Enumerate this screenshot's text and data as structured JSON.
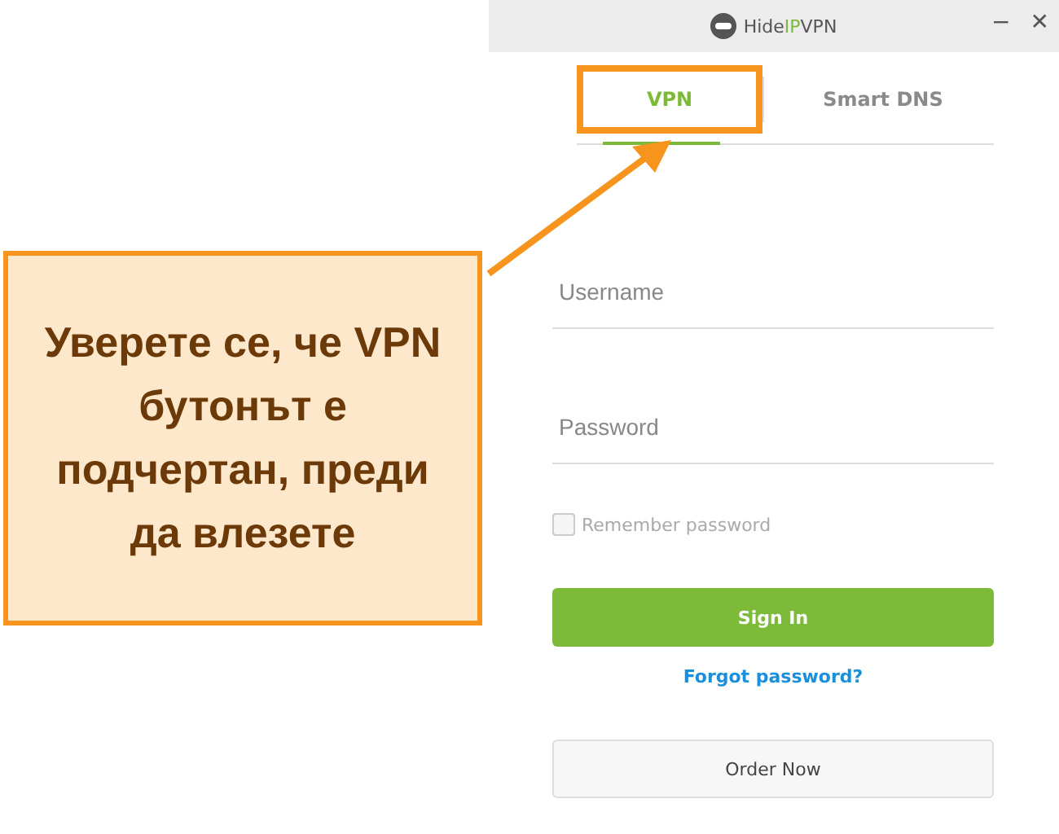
{
  "window": {
    "logo": [
      {
        "text": "Hide",
        "color": "#555555"
      },
      {
        "text": "IP",
        "color": "#7dba3a"
      },
      {
        "text": "VPN",
        "color": "#555555"
      }
    ],
    "controls": [
      "−",
      "✕"
    ]
  },
  "tabs": [
    {
      "label": "VPN",
      "selected": true,
      "highlighted": true
    },
    {
      "label": "Smart DNS",
      "selected": false,
      "highlighted": false
    }
  ],
  "form": {
    "username": {
      "placeholder": "Username"
    },
    "password": {
      "placeholder": "Password"
    },
    "remember": {
      "label": "Remember password",
      "checked": false
    },
    "sign_in": "Sign In",
    "forgot": "Forgot password?",
    "order": "Order Now"
  },
  "callout": {
    "text": "Уверете се, че VPN бутонът е подчертан, преди да влезете"
  }
}
